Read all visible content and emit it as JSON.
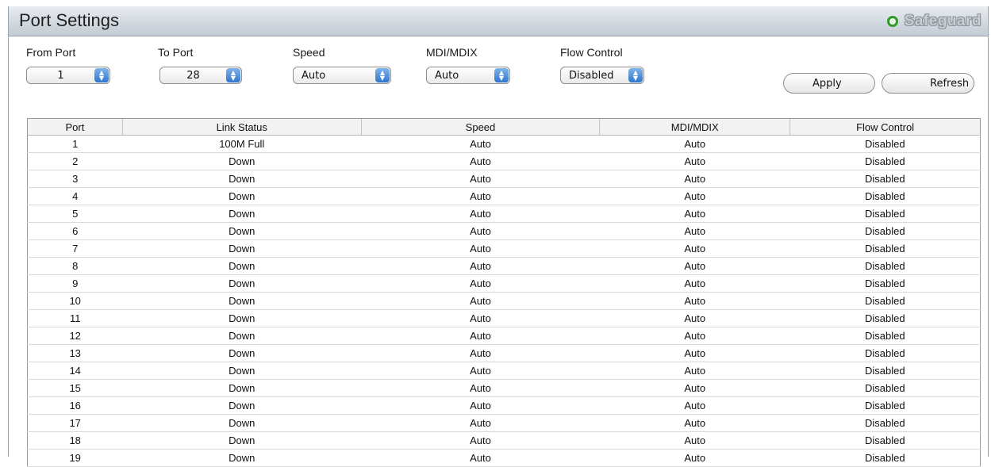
{
  "header": {
    "title": "Port Settings",
    "brand": "Safeguard"
  },
  "controls": {
    "from_port": {
      "label": "From Port",
      "value": "1"
    },
    "to_port": {
      "label": "To Port",
      "value": "28"
    },
    "speed": {
      "label": "Speed",
      "value": "Auto"
    },
    "mdi": {
      "label": "MDI/MDIX",
      "value": "Auto"
    },
    "flow": {
      "label": "Flow Control",
      "value": "Disabled"
    },
    "apply_label": "Apply",
    "refresh_label": "Refresh"
  },
  "table": {
    "columns": [
      "Port",
      "Link Status",
      "Speed",
      "MDI/MDIX",
      "Flow Control"
    ],
    "rows": [
      [
        "1",
        "100M Full",
        "Auto",
        "Auto",
        "Disabled"
      ],
      [
        "2",
        "Down",
        "Auto",
        "Auto",
        "Disabled"
      ],
      [
        "3",
        "Down",
        "Auto",
        "Auto",
        "Disabled"
      ],
      [
        "4",
        "Down",
        "Auto",
        "Auto",
        "Disabled"
      ],
      [
        "5",
        "Down",
        "Auto",
        "Auto",
        "Disabled"
      ],
      [
        "6",
        "Down",
        "Auto",
        "Auto",
        "Disabled"
      ],
      [
        "7",
        "Down",
        "Auto",
        "Auto",
        "Disabled"
      ],
      [
        "8",
        "Down",
        "Auto",
        "Auto",
        "Disabled"
      ],
      [
        "9",
        "Down",
        "Auto",
        "Auto",
        "Disabled"
      ],
      [
        "10",
        "Down",
        "Auto",
        "Auto",
        "Disabled"
      ],
      [
        "11",
        "Down",
        "Auto",
        "Auto",
        "Disabled"
      ],
      [
        "12",
        "Down",
        "Auto",
        "Auto",
        "Disabled"
      ],
      [
        "13",
        "Down",
        "Auto",
        "Auto",
        "Disabled"
      ],
      [
        "14",
        "Down",
        "Auto",
        "Auto",
        "Disabled"
      ],
      [
        "15",
        "Down",
        "Auto",
        "Auto",
        "Disabled"
      ],
      [
        "16",
        "Down",
        "Auto",
        "Auto",
        "Disabled"
      ],
      [
        "17",
        "Down",
        "Auto",
        "Auto",
        "Disabled"
      ],
      [
        "18",
        "Down",
        "Auto",
        "Auto",
        "Disabled"
      ],
      [
        "19",
        "Down",
        "Auto",
        "Auto",
        "Disabled"
      ]
    ]
  },
  "colors": {
    "accent": "#2f76cf",
    "safeguard_icon": "#2e9b28",
    "header_bg": "#d2d9e0"
  },
  "icons": {
    "select_arrow": "up-down-arrows-icon",
    "status": "safeguard-status-icon"
  }
}
